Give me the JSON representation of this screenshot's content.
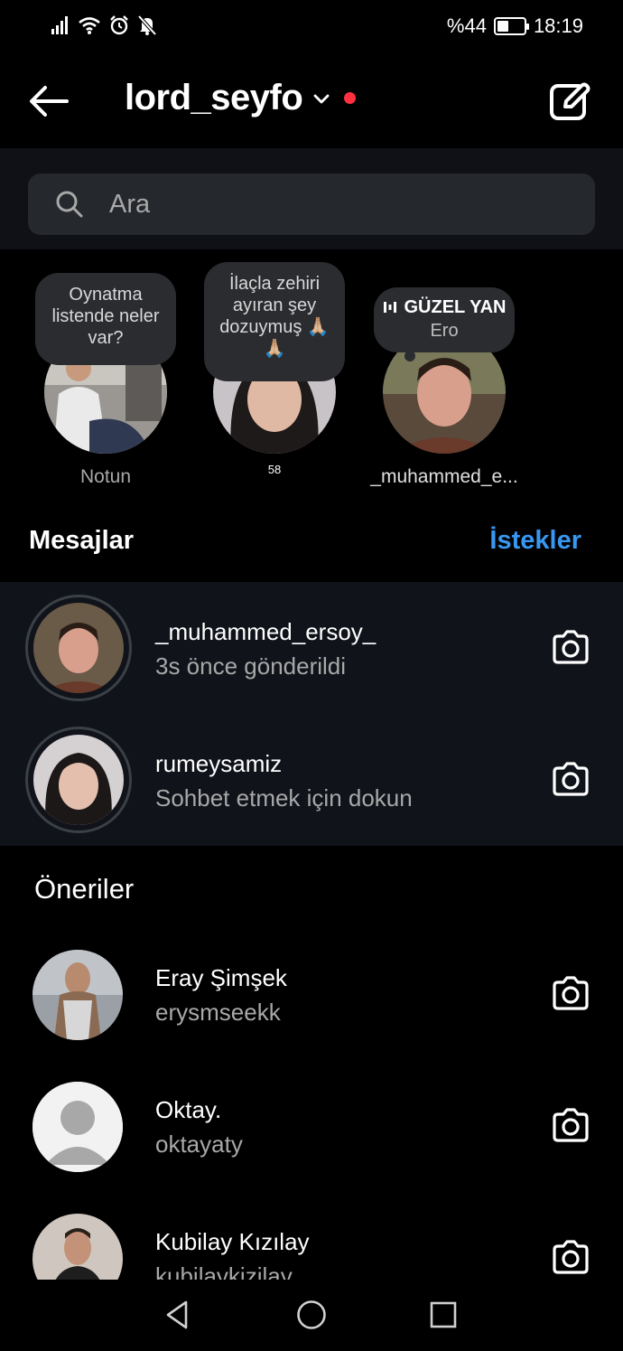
{
  "status": {
    "battery": "%44",
    "battery_level": 0.44,
    "time": "18:19",
    "icons": [
      "signal-icon",
      "wifi-icon",
      "alarm-icon",
      "mute-icon"
    ]
  },
  "header": {
    "username": "lord_seyfo",
    "back_icon": "back-arrow-icon",
    "compose_icon": "compose-icon",
    "dropdown_icon": "chevron-down-icon"
  },
  "search": {
    "placeholder": "Ara",
    "icon": "search-icon"
  },
  "notes": [
    {
      "bubble": "Oynatma listende neler var?",
      "label": "Notun"
    },
    {
      "bubble": "İlaçla zehiri ayıran şey dozuymuş 🙏🏼🙏🏼",
      "label": "58"
    },
    {
      "bubble_title": "GÜZEL YAN",
      "bubble_sub": "Ero",
      "label": "_muhammed_e..."
    }
  ],
  "messages_section": {
    "title": "Mesajlar",
    "requests": "İstekler"
  },
  "messages": [
    {
      "name": "_muhammed_ersoy_",
      "sub": "3s önce gönderildi"
    },
    {
      "name": "rumeysamiz",
      "sub": "Sohbet etmek için dokun"
    }
  ],
  "suggestions_section": {
    "title": "Öneriler"
  },
  "suggestions": [
    {
      "name": "Eray Şimşek",
      "sub": "erysmseekk"
    },
    {
      "name": "Oktay.",
      "sub": "oktayaty"
    },
    {
      "name": "Kubilay Kızılay",
      "sub": "kubilaykizilay"
    }
  ],
  "colors": {
    "accent": "#3897f0",
    "notification": "#ff3040",
    "background": "#000000",
    "highlight": "#10131a"
  }
}
